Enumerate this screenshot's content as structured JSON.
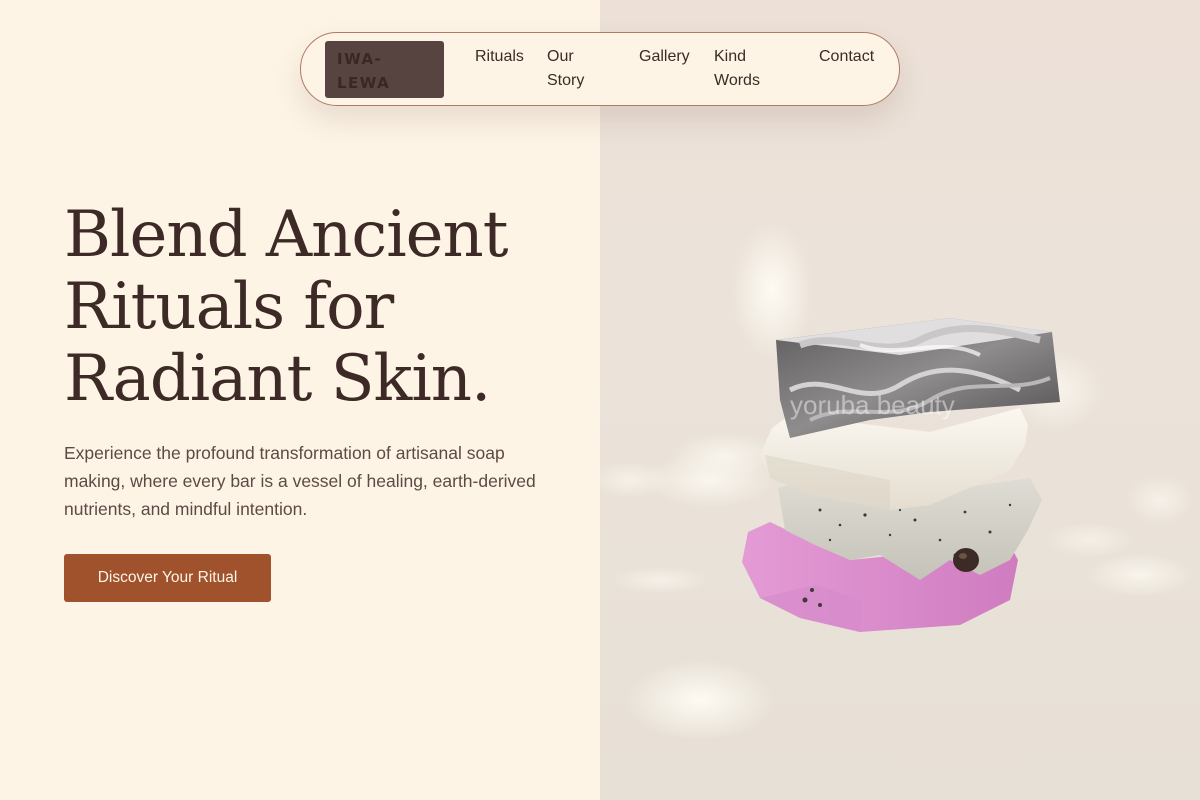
{
  "nav": {
    "logo": "IWA-LEWA",
    "links": [
      "Rituals",
      "Our Story",
      "Gallery",
      "Kind Words",
      "Contact"
    ]
  },
  "hero": {
    "title_lines": [
      "Blend Ancient",
      "Rituals for",
      "Radiant Skin."
    ],
    "description": "Experience the profound transformation of artisanal soap making, where every bar is a vessel of healing, earth-derived nutrients, and mindful intention.",
    "cta_label": "Discover Your Ritual",
    "image_watermark": "yoruba beauty"
  },
  "colors": {
    "background": "#fdf4e6",
    "text": "#3d2a26",
    "accent": "#a0522d",
    "logo_bg": "#574340",
    "nav_border": "#b07a63"
  },
  "icons": [
    "soap-stack-image"
  ]
}
